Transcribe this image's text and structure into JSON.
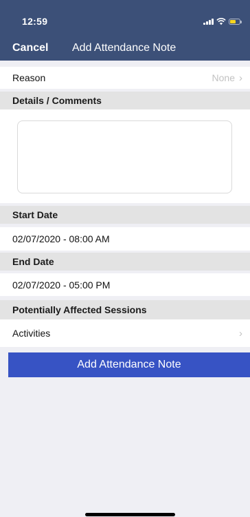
{
  "status_bar": {
    "time": "12:59"
  },
  "nav": {
    "cancel_label": "Cancel",
    "title": "Add Attendance Note"
  },
  "reason": {
    "label": "Reason",
    "value": "None",
    "chevron": "›"
  },
  "details": {
    "header": "Details / Comments",
    "value": ""
  },
  "start_date": {
    "header": "Start Date",
    "value": "02/07/2020 - 08:00 AM"
  },
  "end_date": {
    "header": "End Date",
    "value": "02/07/2020 - 05:00 PM"
  },
  "sessions": {
    "header": "Potentially Affected Sessions",
    "activities_label": "Activities",
    "chevron": "›"
  },
  "submit_label": "Add Attendance Note",
  "colors": {
    "nav_bar": "#3c5078",
    "submit_button": "#3753c4",
    "section_header": "#e3e3e3",
    "background": "#efeff4",
    "battery": "#f7d51f"
  },
  "icons": [
    "signal-icon",
    "wifi-icon",
    "battery-icon",
    "chevron-right-icon"
  ]
}
